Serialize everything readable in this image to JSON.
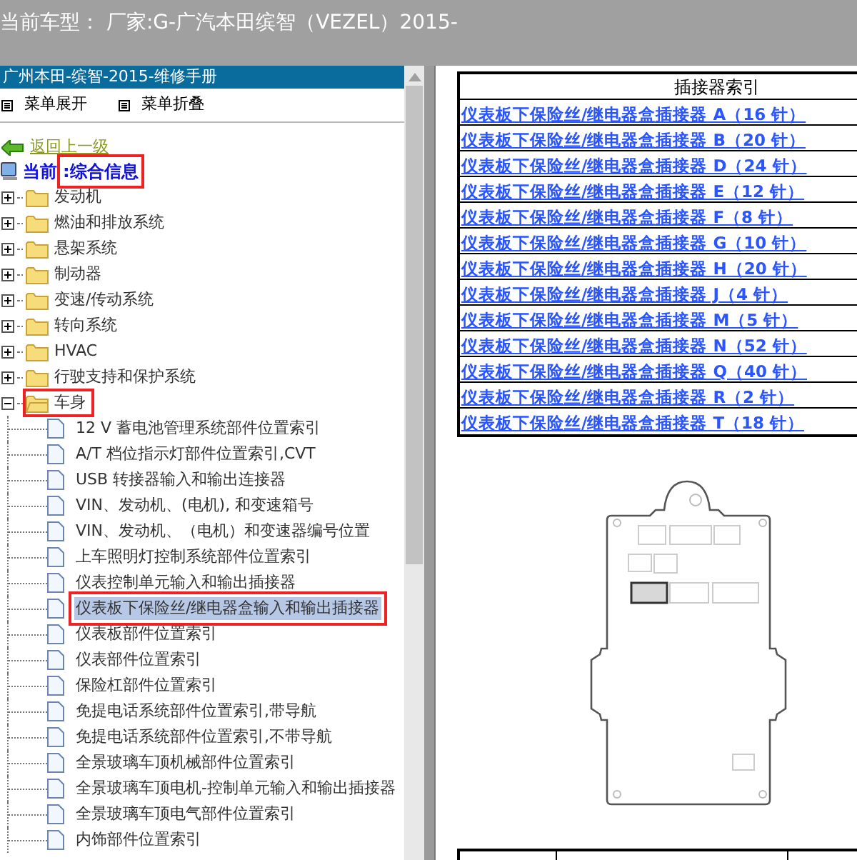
{
  "header": {
    "title": "当前车型： 厂家:G-广汽本田缤智（VEZEL）2015-"
  },
  "manual": {
    "title": "广州本田-缤智-2015-维修手册"
  },
  "toolbar": [
    {
      "label": "菜单展开"
    },
    {
      "label": "菜单折叠"
    }
  ],
  "back_link": "返回上一级",
  "current": {
    "prefix": "当前",
    "value": ":综合信息",
    "highlighted": true
  },
  "tree": [
    {
      "label": "发动机",
      "expanded": false,
      "highlighted": false
    },
    {
      "label": "燃油和排放系统",
      "expanded": false,
      "highlighted": false
    },
    {
      "label": "悬架系统",
      "expanded": false,
      "highlighted": false
    },
    {
      "label": "制动器",
      "expanded": false,
      "highlighted": false
    },
    {
      "label": "变速/传动系统",
      "expanded": false,
      "highlighted": false
    },
    {
      "label": "转向系统",
      "expanded": false,
      "highlighted": false
    },
    {
      "label": "HVAC",
      "expanded": false,
      "highlighted": false
    },
    {
      "label": "行驶支持和保护系统",
      "expanded": false,
      "highlighted": false
    },
    {
      "label": "车身",
      "expanded": true,
      "highlighted": true,
      "children": [
        {
          "label": "12 V 蓄电池管理系统部件位置索引",
          "selected": false
        },
        {
          "label": "A/T 档位指示灯部件位置索引,CVT",
          "selected": false
        },
        {
          "label": "USB 转接器输入和输出连接器",
          "selected": false
        },
        {
          "label": "VIN、发动机、(电机), 和变速箱号",
          "selected": false
        },
        {
          "label": "VIN、发动机、（电机）和变速器编号位置",
          "selected": false
        },
        {
          "label": "上车照明灯控制系统部件位置索引",
          "selected": false
        },
        {
          "label": "仪表控制单元输入和输出插接器",
          "selected": false
        },
        {
          "label": "仪表板下保险丝/继电器盒输入和输出插接器",
          "selected": true
        },
        {
          "label": "仪表板部件位置索引",
          "selected": false
        },
        {
          "label": "仪表部件位置索引",
          "selected": false
        },
        {
          "label": "保险杠部件位置索引",
          "selected": false
        },
        {
          "label": "免提电话系统部件位置索引,带导航",
          "selected": false
        },
        {
          "label": "免提电话系统部件位置索引,不带导航",
          "selected": false
        },
        {
          "label": "全景玻璃车顶机械部件位置索引",
          "selected": false
        },
        {
          "label": "全景玻璃车顶电机-控制单元输入和输出插接器",
          "selected": false
        },
        {
          "label": "全景玻璃车顶电气部件位置索引",
          "selected": false
        },
        {
          "label": "内饰部件位置索引",
          "selected": false
        }
      ]
    }
  ],
  "connector_index": {
    "title": "插接器索引",
    "rows": [
      "仪表板下保险丝/继电器盒插接器 A（16 针）",
      "仪表板下保险丝/继电器盒插接器 B（20 针）",
      "仪表板下保险丝/继电器盒插接器 D（24 针）",
      "仪表板下保险丝/继电器盒插接器 E（12 针）",
      "仪表板下保险丝/继电器盒插接器 F（8 针）",
      "仪表板下保险丝/继电器盒插接器 G（10 针）",
      "仪表板下保险丝/继电器盒插接器 H（20 针）",
      "仪表板下保险丝/继电器盒插接器 J（4 针）",
      "仪表板下保险丝/继电器盒插接器 M（5 针）",
      "仪表板下保险丝/继电器盒插接器 N（52 针）",
      "仪表板下保险丝/继电器盒插接器 Q（40 针）",
      "仪表板下保险丝/继电器盒插接器 R（2 针）",
      "仪表板下保险丝/继电器盒插接器 T（18 针）"
    ]
  }
}
